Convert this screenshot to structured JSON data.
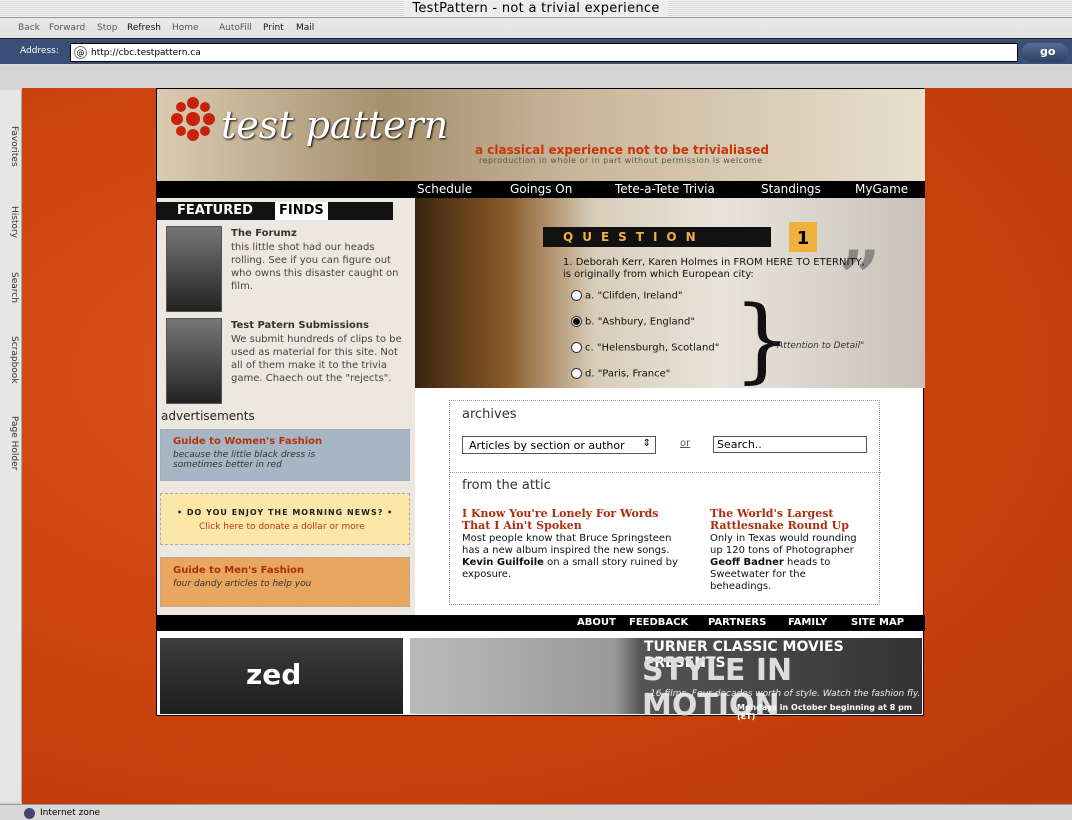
{
  "browser": {
    "title": "TestPattern - not a trivial experience",
    "toolbar": [
      "Back",
      "Forward",
      "Stop",
      "Refresh",
      "Home",
      "AutoFill",
      "Print",
      "Mail"
    ],
    "address_label": "Address:",
    "url": "http://cbc.testpattern.ca",
    "go": "go",
    "sidebar_tabs": [
      "Favorites",
      "History",
      "Search",
      "Scrapbook",
      "Page Holder"
    ],
    "status": "Internet zone"
  },
  "site": {
    "logo_text": "test pattern",
    "tagline": "a classical experience not to be trivialiased",
    "repro": "reproduction in whole or in part without permission is welcome",
    "nav": [
      "Schedule",
      "Goings On",
      "Tete-a-Tete Trivia",
      "Standings",
      "MyGame"
    ],
    "featured": {
      "head1": "FEATURED",
      "head2": "FINDS",
      "items": [
        {
          "title": "The Forumz",
          "desc": "this little shot had our heads rolling. See if you can figure out who owns this disaster caught on film."
        },
        {
          "title": "Test Patern Submissions",
          "desc": "We submit hundreds of clips to be used as material for this site. Not all of them make it to the trivia game. Chaech out the \"rejects\"."
        }
      ]
    },
    "ads": {
      "head": "advertisements",
      "items": [
        {
          "title": "Guide to Women's Fashion",
          "sub": "because the little black dress is sometimes better in red"
        },
        {
          "title": "• DO YOU ENJOY THE MORNING NEWS? •",
          "sub": "Click here to donate a dollar or more"
        },
        {
          "title": "Guide to Men's Fashion",
          "sub": "four dandy articles to help you"
        }
      ]
    },
    "quiz": {
      "label": "QUESTION",
      "number": "1",
      "question": "1. Deborah Kerr, Karen Holmes in FROM HERE TO ETERNITY, is originally from which European city:",
      "options": [
        "a. \"Clifden, Ireland\"",
        "b. \"Ashbury, England\"",
        "c. \"Helensburgh, Scotland\"",
        "d. \"Paris, France\""
      ],
      "selected": 1,
      "note": "\"Attention to Detail\""
    },
    "archives": {
      "head": "archives",
      "select": "Articles by section or author",
      "or": "or",
      "search": "Search.."
    },
    "attic": {
      "head": "from the attic",
      "left_title": "I Know You're Lonely For Words That I Ain't Spoken",
      "left_body1": "Most people know that Bruce Springsteen has a new album inspired the new songs.",
      "left_author": "Kevin Guilfoile",
      "left_body2": "on a small story ruined by exposure.",
      "right_title": "The World's Largest Rattlesnake Round Up",
      "right_body1": "Only in Texas would rounding up 120 tons of Photographer",
      "right_author": "Geoff Badner",
      "right_body2": "heads to Sweetwater for the beheadings."
    },
    "footer": [
      "ABOUT",
      "FEEDBACK",
      "PARTNERS",
      "FAMILY",
      "SITE MAP"
    ],
    "zed": "zed",
    "tcm": {
      "line1": "TURNER CLASSIC MOVIES PRESENTS",
      "line2": "STYLE IN MOTION",
      "line3": "16 films. Four decades worth of style. Watch the fashion fly.",
      "line4": "Mondays in October beginning at 8 pm (ET)"
    }
  }
}
